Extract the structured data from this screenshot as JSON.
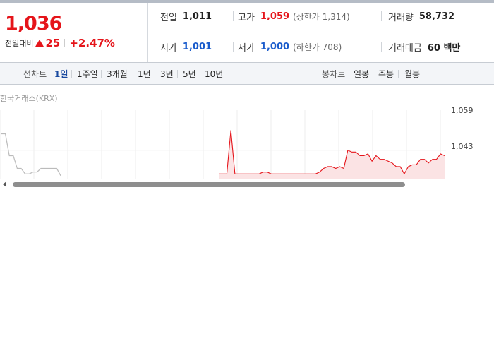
{
  "quote": {
    "price": "1,036",
    "change_label": "전일대비",
    "change_value": "25",
    "change_pct": "+2.47%",
    "up_color": "#e5141a",
    "down_color": "#1a5ccc"
  },
  "stats": {
    "prev_close_label": "전일",
    "prev_close": "1,011",
    "high_label": "고가",
    "high": "1,059",
    "upper_limit": "(상한가 1,314)",
    "volume_label": "거래량",
    "volume": "58,732",
    "open_label": "시가",
    "open": "1,001",
    "low_label": "저가",
    "low": "1,000",
    "lower_limit": "(하한가 708)",
    "amount_label": "거래대금",
    "amount": "60 백만"
  },
  "tabs": {
    "line_chart_label": "선차트",
    "line_periods": [
      "1일",
      "1주일",
      "3개월",
      "1년",
      "3년",
      "5년",
      "10년"
    ],
    "active_period": "1일",
    "candle_chart_label": "봉차트",
    "candle_periods": [
      "일봉",
      "주봉",
      "월봉"
    ]
  },
  "chart": {
    "source": "한국거래소(KRX)",
    "y_ticks": [
      "1,059",
      "1,043"
    ]
  },
  "chart_data": {
    "type": "line",
    "title": "",
    "xlabel": "",
    "ylabel": "",
    "ylim": [
      1027,
      1065
    ],
    "y_ticks": [
      1059,
      1043
    ],
    "grid": true,
    "series": [
      {
        "color": "#bbbbbb",
        "values": [
          1052,
          1052,
          1040,
          1040,
          1033,
          1033,
          1030,
          1030,
          1031,
          1031,
          1033,
          1033,
          1033,
          1033,
          1033,
          1029
        ]
      },
      {
        "color": "#e5141a",
        "values": [
          1030,
          1030,
          1030,
          1054,
          1030,
          1030,
          1030,
          1030,
          1030,
          1030,
          1030,
          1031,
          1031,
          1030,
          1030,
          1030,
          1030,
          1030,
          1030,
          1030,
          1030,
          1030,
          1030,
          1030,
          1030,
          1031,
          1033,
          1034,
          1034,
          1033,
          1034,
          1033,
          1043,
          1042,
          1042,
          1040,
          1040,
          1041,
          1037,
          1040,
          1038,
          1038,
          1037,
          1036,
          1034,
          1034,
          1030,
          1034,
          1035,
          1035,
          1038,
          1038,
          1036,
          1038,
          1038,
          1041,
          1040
        ]
      }
    ]
  }
}
